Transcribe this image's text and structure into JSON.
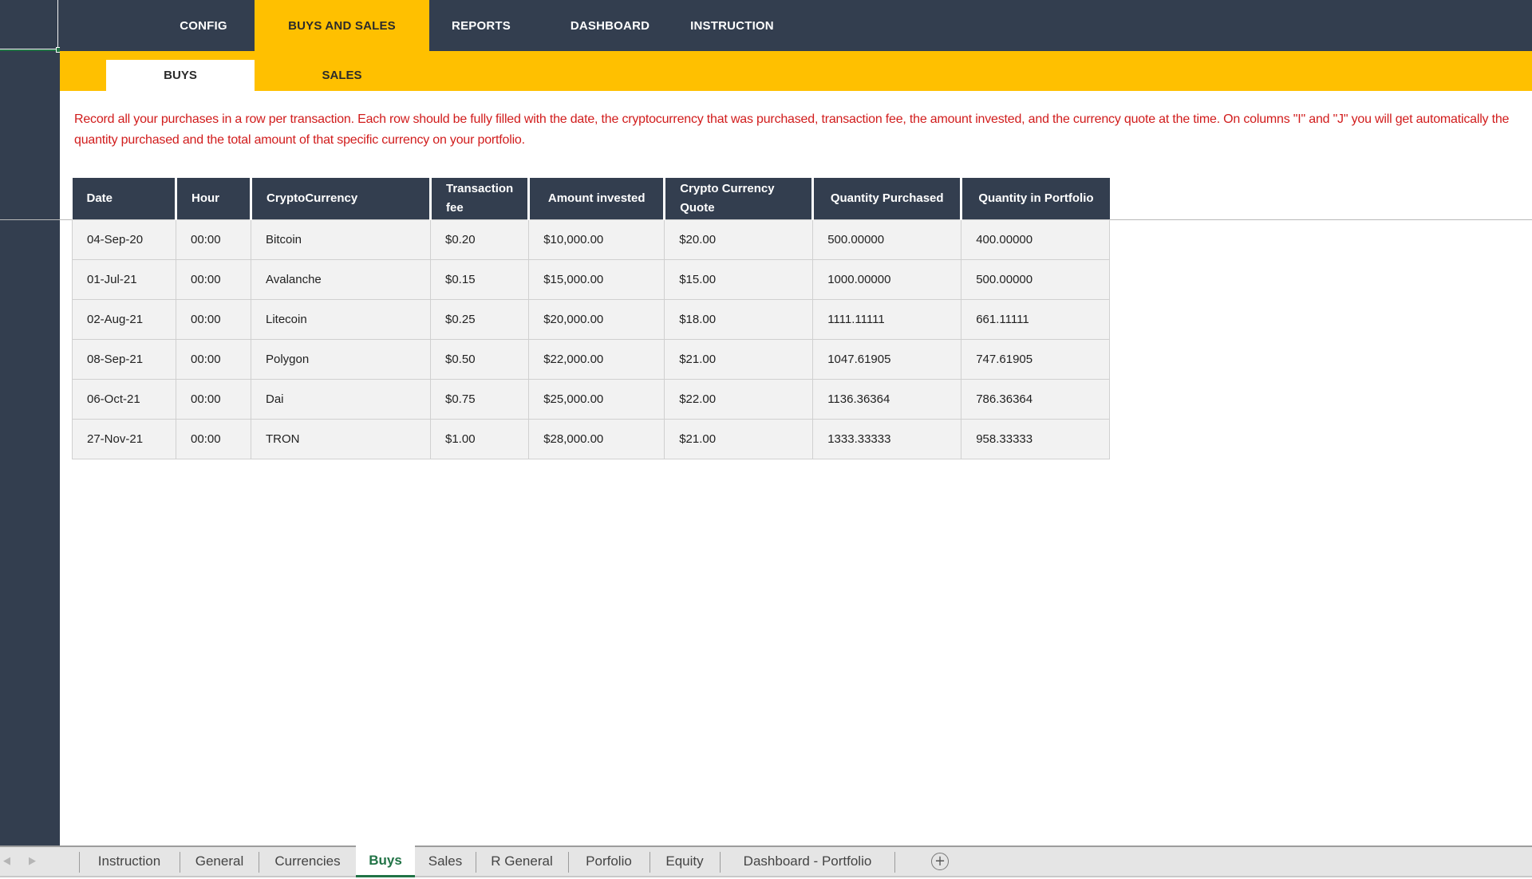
{
  "topnav": {
    "items": [
      {
        "label": "CONFIG",
        "active": false
      },
      {
        "label": "BUYS AND SALES",
        "active": true
      },
      {
        "label": "REPORTS",
        "active": false
      },
      {
        "label": "DASHBOARD",
        "active": false
      },
      {
        "label": "INSTRUCTION",
        "active": false
      }
    ]
  },
  "subnav": {
    "items": [
      {
        "label": "BUYS",
        "active": true
      },
      {
        "label": "SALES",
        "active": false
      }
    ]
  },
  "instructions": {
    "text": "Record all your purchases in a row per transaction. Each row should be fully filled with the date, the cryptocurrency that was purchased, transaction fee, the amount invested, and the currency quote at the time. On columns \"I\" and \"J\" you will get automatically the quantity purchased and the total amount of that specific currency on your portfolio."
  },
  "table": {
    "headers": [
      "Date",
      "Hour",
      "CryptoCurrency",
      "Transaction fee",
      "Amount invested",
      "Crypto Currency Quote",
      "Quantity Purchased",
      "Quantity in Portfolio"
    ],
    "rows": [
      [
        "04-Sep-20",
        "00:00",
        "Bitcoin",
        "$0.20",
        "$10,000.00",
        "$20.00",
        "500.00000",
        "400.00000"
      ],
      [
        "01-Jul-21",
        "00:00",
        "Avalanche",
        "$0.15",
        "$15,000.00",
        "$15.00",
        "1000.00000",
        "500.00000"
      ],
      [
        "02-Aug-21",
        "00:00",
        "Litecoin",
        "$0.25",
        "$20,000.00",
        "$18.00",
        "1111.11111",
        "661.11111"
      ],
      [
        "08-Sep-21",
        "00:00",
        "Polygon",
        "$0.50",
        "$22,000.00",
        "$21.00",
        "1047.61905",
        "747.61905"
      ],
      [
        "06-Oct-21",
        "00:00",
        "Dai",
        "$0.75",
        "$25,000.00",
        "$22.00",
        "1136.36364",
        "786.36364"
      ],
      [
        "27-Nov-21",
        "00:00",
        "TRON",
        "$1.00",
        "$28,000.00",
        "$21.00",
        "1333.33333",
        "958.33333"
      ]
    ]
  },
  "sheet_tabs": {
    "items": [
      {
        "label": "Instruction",
        "active": false
      },
      {
        "label": "General",
        "active": false
      },
      {
        "label": "Currencies",
        "active": false
      },
      {
        "label": "Buys",
        "active": true
      },
      {
        "label": "Sales",
        "active": false
      },
      {
        "label": "R General",
        "active": false
      },
      {
        "label": "Porfolio",
        "active": false
      },
      {
        "label": "Equity",
        "active": false
      },
      {
        "label": "Dashboard - Portfolio",
        "active": false
      }
    ],
    "prev_icon": "◀",
    "next_icon": "▶",
    "add_icon": "+"
  },
  "colors": {
    "navy": "#333e4f",
    "accent_yellow": "#ffc000",
    "instruction_red": "#d11c1c",
    "excel_green": "#217346"
  }
}
